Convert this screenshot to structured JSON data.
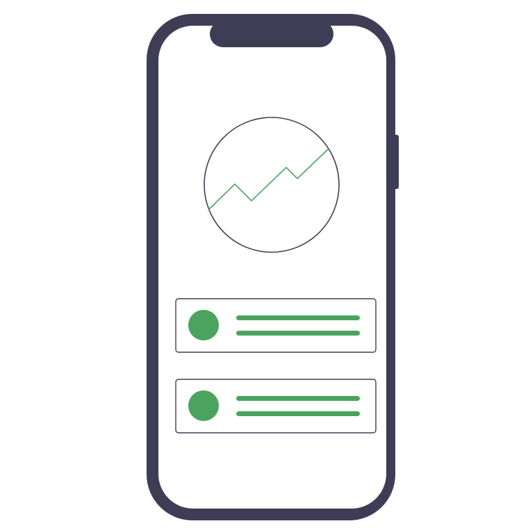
{
  "colors": {
    "frame": "#3f3d56",
    "accent": "#4ba35e",
    "screen": "#ffffff",
    "background": "#ffffff"
  },
  "icons": {
    "trend": "trend-up-icon",
    "avatar": "avatar-circle"
  },
  "items": [
    {
      "lines": 2
    },
    {
      "lines": 2
    }
  ]
}
